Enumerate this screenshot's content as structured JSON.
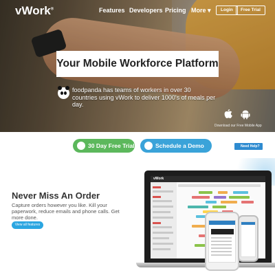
{
  "nav": {
    "logo": "vWork",
    "logo_mark": "®",
    "links": [
      "Features",
      "Developers",
      "Pricing",
      "More ▾"
    ],
    "login": "Login",
    "free_trial": "Free Trial"
  },
  "hero": {
    "headline": "Your Mobile Workforce Platform",
    "testimonial": "foodpanda has teams of workers in over 30 countries using vWork to deliver 1000's of meals per day.",
    "app_caption": "Download our Free Mobile App",
    "icons": [
      "apple-icon",
      "android-icon",
      "panda-icon"
    ]
  },
  "cta": {
    "trial": "30 Day Free Trial",
    "demo": "Schedule a Demo",
    "trial_color": "#5cb85c",
    "demo_color": "#3aa3d9"
  },
  "help": {
    "label": "Need Help?"
  },
  "feature": {
    "title": "Never Miss An Order",
    "body": "Capture orders however you like. Kill your paperwork, reduce emails and phone calls. Get more done.",
    "button": "View all features"
  },
  "mockup": {
    "brand": "vWork"
  },
  "colors": {
    "accent_blue": "#2ba6e1",
    "green": "#5cb85c",
    "help_blue": "#2e8bd0"
  }
}
